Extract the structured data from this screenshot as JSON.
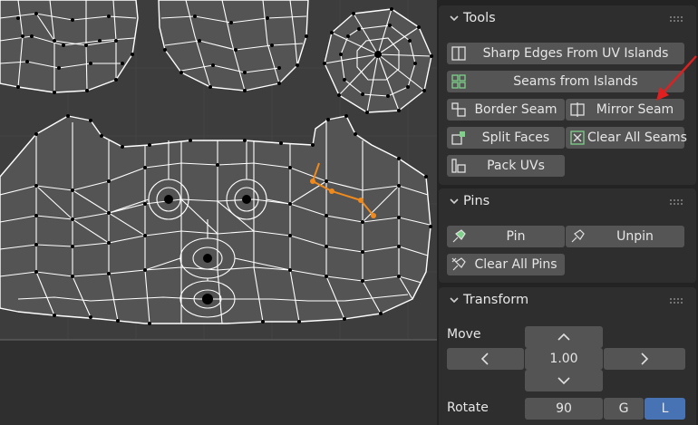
{
  "panels": {
    "tools": {
      "title": "Tools",
      "buttons": {
        "sharp_edges": "Sharp Edges From UV Islands",
        "seams_from_islands": "Seams from Islands",
        "border_seam": "Border Seam",
        "mirror_seam": "Mirror Seam",
        "split_faces": "Split Faces",
        "clear_all_seams": "Clear All Seams",
        "pack_uvs": "Pack UVs"
      }
    },
    "pins": {
      "title": "Pins",
      "buttons": {
        "pin": "Pin",
        "unpin": "Unpin",
        "clear_all_pins": "Clear All Pins"
      }
    },
    "transform": {
      "title": "Transform",
      "move_label": "Move",
      "move_value": "1.00",
      "rotate_label": "Rotate",
      "rotate_value": "90",
      "rotate_mode_g": "G",
      "rotate_mode_l": "L"
    }
  },
  "colors": {
    "accent_blue": "#4772b3",
    "annotation_arrow": "#e02020",
    "selected_edge": "#f08a1c"
  },
  "icons": [
    "panel-collapse-chevron-icon",
    "drag-grip-icon",
    "sharp-edges-icon",
    "seams-islands-icon",
    "border-seam-icon",
    "mirror-seam-icon",
    "split-faces-icon",
    "clear-seams-icon",
    "pack-uvs-icon",
    "pin-icon",
    "unpin-icon",
    "clear-pins-icon",
    "chevron-up-icon",
    "chevron-down-icon",
    "chevron-left-icon",
    "chevron-right-icon"
  ]
}
